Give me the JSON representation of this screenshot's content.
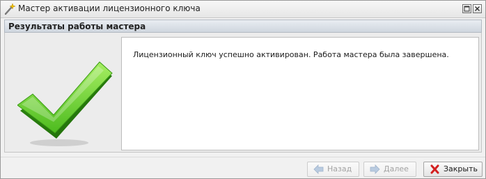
{
  "window": {
    "title": "Мастер активации лицензионного ключа",
    "title_icon": "wand-icon"
  },
  "section": {
    "header": "Результаты работы мастера"
  },
  "result": {
    "status_icon": "checkmark-icon",
    "status_color": "#4dbb1f",
    "message": "Лицензионный ключ успешно активирован. Работа мастера была завершена."
  },
  "buttons": {
    "back_label": "Назад",
    "back_enabled": false,
    "next_label": "Далее",
    "next_enabled": false,
    "close_label": "Закрыть",
    "close_icon_color": "#d32020"
  }
}
